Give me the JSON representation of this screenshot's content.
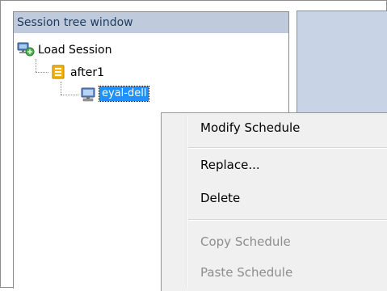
{
  "session_tree": {
    "title": "Session tree window",
    "root": {
      "label": "Load Session",
      "icon": "load-session-icon"
    },
    "child": {
      "label": "after1",
      "icon": "schedule-folder-icon"
    },
    "grandchild": {
      "label": "eyal-dell",
      "icon": "computer-icon",
      "selected": true
    }
  },
  "context_menu": {
    "items": [
      {
        "label": "Modify Schedule",
        "enabled": true
      },
      {
        "label": "Replace...",
        "enabled": true
      },
      {
        "label": "Delete",
        "enabled": true
      },
      {
        "label": "Copy Schedule",
        "enabled": false
      },
      {
        "label": "Paste Schedule",
        "enabled": false
      }
    ]
  },
  "colors": {
    "header_bg": "#bfcbdc",
    "selection_bg": "#1e90ff",
    "right_panel_bg": "#c8d4e6",
    "menu_bg": "#f0f0f0",
    "disabled_text": "#8d8d8d"
  }
}
